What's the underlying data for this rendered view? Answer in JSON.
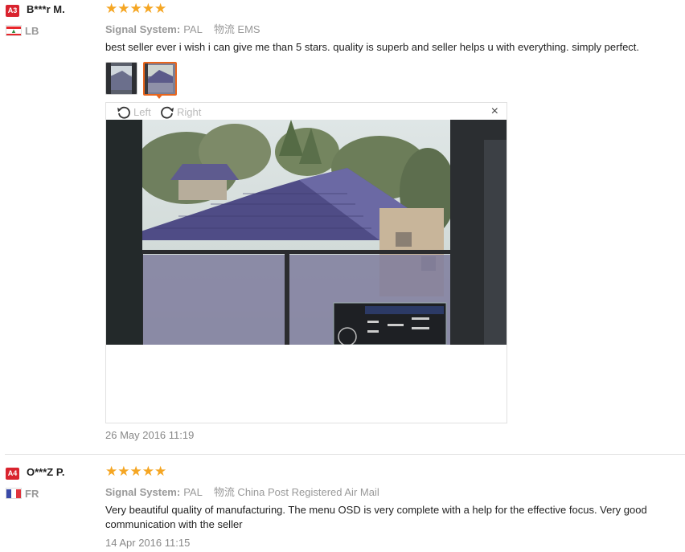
{
  "reviews": [
    {
      "level": "A3",
      "user": "B***r M.",
      "country": "LB",
      "stars": "★★★★★",
      "rating": 5,
      "attr_label": "Signal System:",
      "attr_value": "PAL",
      "shipping": "物流 EMS",
      "text": "best seller ever i wish i can give me than 5 stars. quality is superb and seller helps u with everything. simply perfect.",
      "date": "26 May 2016 11:19",
      "viewer": {
        "rotate_left": "Left",
        "rotate_right": "Right",
        "close": "×"
      }
    },
    {
      "level": "A4",
      "user": "O***Z P.",
      "country": "FR",
      "stars": "★★★★★",
      "rating": 5,
      "attr_label": "Signal System:",
      "attr_value": "PAL",
      "shipping": "物流 China Post Registered Air Mail",
      "text": "Very beautiful quality of manufacturing. The menu OSD is very complete with a help for the effective focus. Very good communication with the seller",
      "date": "14 Apr 2016 11:15"
    }
  ],
  "colors": {
    "level_badge": "#d9232e",
    "stars": "#f5a623",
    "thumb_selected": "#e8651c"
  }
}
